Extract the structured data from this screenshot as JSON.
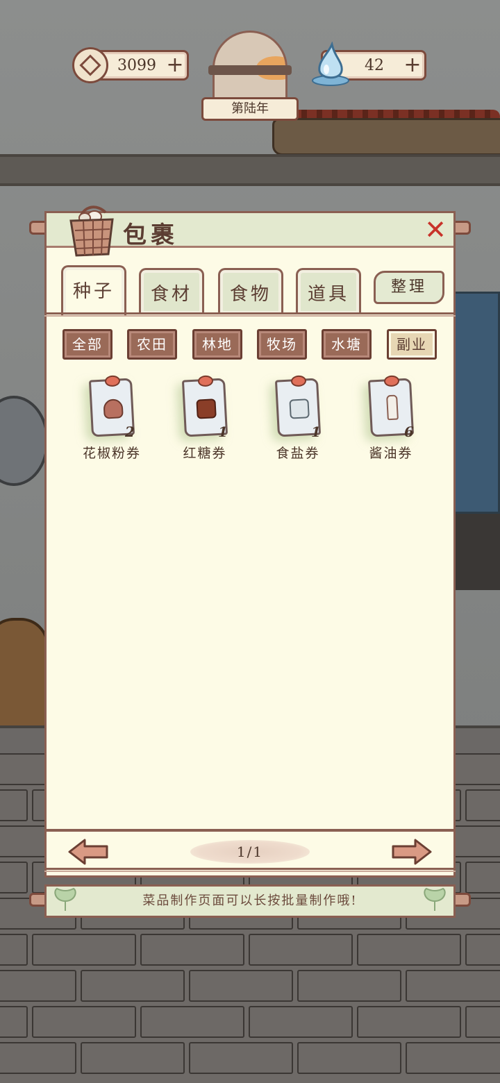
{
  "hud": {
    "coins": "3099",
    "coin_plus": "+",
    "gems": "42",
    "gem_plus": "+",
    "year_label": "第陆年"
  },
  "bag": {
    "title": "包裹",
    "close_glyph": "✕",
    "tabs": [
      {
        "label": "种子",
        "active": true
      },
      {
        "label": "食材",
        "active": false
      },
      {
        "label": "食物",
        "active": false
      },
      {
        "label": "道具",
        "active": false
      }
    ],
    "sort_label": "整理",
    "filters": [
      {
        "label": "全部",
        "active": false
      },
      {
        "label": "农田",
        "active": false
      },
      {
        "label": "林地",
        "active": false
      },
      {
        "label": "牧场",
        "active": false
      },
      {
        "label": "水塘",
        "active": false
      },
      {
        "label": "副业",
        "active": true
      }
    ],
    "items": [
      {
        "name": "花椒粉券",
        "count": "2",
        "icon": "pepper-powder-jar-icon"
      },
      {
        "name": "红糖券",
        "count": "1",
        "icon": "brown-sugar-cubes-icon"
      },
      {
        "name": "食盐券",
        "count": "1",
        "icon": "salt-box-icon"
      },
      {
        "name": "酱油券",
        "count": "6",
        "icon": "soy-sauce-bottle-icon"
      }
    ],
    "page_indicator": "1/1"
  },
  "tip": "菜品制作页面可以长按批量制作哦!",
  "colors": {
    "panel_bg": "#fdfbe6",
    "header_bg": "#e3e9cf",
    "border": "#8a5f52",
    "filter_bg": "#9a6a58",
    "close": "#c8332a"
  }
}
